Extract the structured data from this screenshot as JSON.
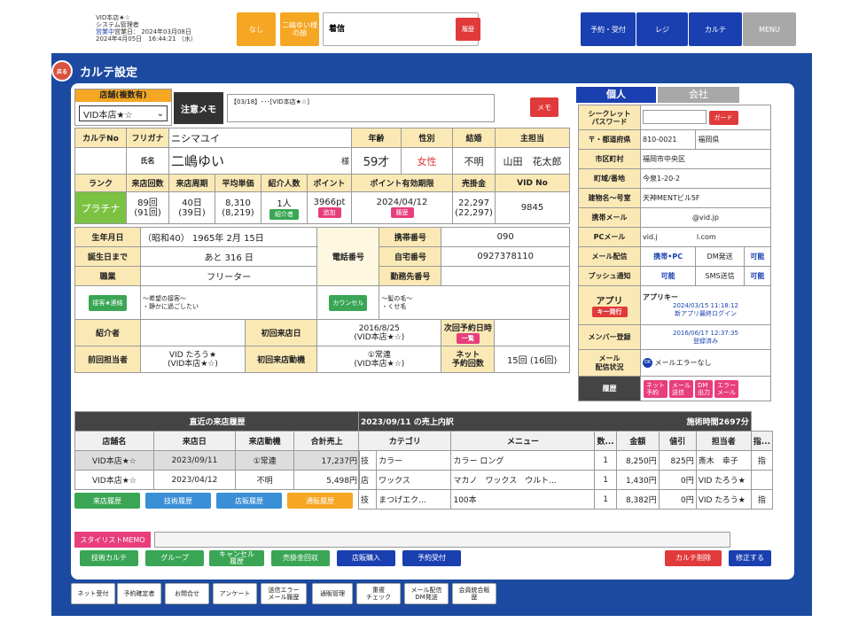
{
  "sysinfo": {
    "store": "VID本店★☆",
    "user": "システム管理者",
    "bizdate_label": "営業中",
    "bizdate": "営業日： 2024年03月08日",
    "now": "2024年4月05日　16:44:21 （水）"
  },
  "top": {
    "none": "なし",
    "customer": "二嶋ゆい様の顔",
    "incoming": "着信",
    "history": "履歴",
    "reserve": "予約・受付",
    "register": "レジ",
    "karte": "カルテ",
    "menu": "MENU"
  },
  "title": "カルテ設定",
  "back": "戻る",
  "store_sel": {
    "label": "店舗(複数有)",
    "value": "VID本店★☆"
  },
  "memo": {
    "label": "注意メモ",
    "text": "【03/18】･･･[VID本店★☆]",
    "btn": "メモ"
  },
  "customer": {
    "h_no": "カルテNo",
    "h_kana": "フリガナ",
    "kana": "ニシマユイ",
    "h_age": "年齢",
    "h_sex": "性別",
    "h_married": "結婚",
    "h_staff": "主担当",
    "h_name": "氏名",
    "name": "二嶋ゆい",
    "sama": "様",
    "age": "59才",
    "sex": "女性",
    "married": "不明",
    "staff": "山田　花太郎",
    "h_rank": "ランク",
    "h_visits": "来店回数",
    "h_cycle": "来店周期",
    "h_avg": "平均単価",
    "h_intro": "紹介人数",
    "h_point": "ポイント",
    "h_pexp": "ポイント有効期限",
    "h_sales": "売掛金",
    "h_vid": "VID No",
    "rank": "プラチナ",
    "visits": "89回\n(91回)",
    "cycle": "40日\n(39日)",
    "avg": "8,310\n(8,219)",
    "intro": "1人",
    "intro_btn": "紹介者",
    "point": "3966pt",
    "point_btn": "追加",
    "pexp": "2024/04/12",
    "pexp_btn": "履歴",
    "sales": "22,297\n(22,297)",
    "vid": "9845",
    "h_birth": "生年月日",
    "birth": "（昭和40） 1965年 2月 15日",
    "h_tel": "電話番号",
    "h_mobile": "携帯番号",
    "mobile": "090",
    "h_tobirth": "誕生日まで",
    "tobirth": "あと 316 日",
    "h_home": "自宅番号",
    "home": "0927378110",
    "h_job": "職業",
    "job": "フリーター",
    "h_work": "勤務先番号",
    "contact_btn": "接客★連絡",
    "contact_note": "～希望の接客～\n・静かに過ごしたい",
    "counsel_btn": "カウンセル",
    "counsel_note": "～髪の毛～\n・くせ毛",
    "h_referrer": "紹介者",
    "h_firstvisit": "初回来店日",
    "firstvisit": "2016/8/25\n(VID本店★☆)",
    "h_nextres": "次回予約日時",
    "nextres_btn": "一覧",
    "h_prevstaff": "前回担当者",
    "prevstaff": "VID たろう★\n(VID本店★☆)",
    "h_firstmotive": "初回来店動機",
    "firstmotive": "①常連\n(VID本店★☆)",
    "h_netres": "ネット\n予約回数",
    "netres": "15回 (16回)"
  },
  "right": {
    "tab_personal": "個人",
    "tab_company": "会社",
    "h_secret": "シークレット\nパスワード",
    "guard": "ガード",
    "h_zip": "〒・都道府県",
    "zip": "810-0021",
    "pref": "福岡県",
    "h_city": "市区町村",
    "city": "福岡市中央区",
    "h_town": "町域/番地",
    "town": "今泉1-20-2",
    "h_bldg": "建物名～号室",
    "bldg": "天神MENTビル5F",
    "h_mobilemail": "携帯メール",
    "mobilemail": "@vid.jp",
    "h_pcmail": "PCメール",
    "pcmail_a": "vid.j",
    "pcmail_b": "l.com",
    "h_maildist": "メール配信",
    "maildist": "携帯•PC",
    "dm": "DM発送",
    "dm_v": "可能",
    "h_push": "プッシュ通知",
    "push": "可能",
    "sms": "SMS送信",
    "sms_v": "可能",
    "h_app": "アプリ",
    "appkey_btn": "キー発行",
    "appkey": "アプリキー",
    "app_login": "2024/03/15 11:18:12\n新アプリ最終ログイン",
    "h_member": "メンバー登録",
    "member": "2016/06/17 12:37:35\n登録済み",
    "h_mailstatus": "メール\n配信状況",
    "mailstatus": "メールエラーなし",
    "h_hist": "履歴",
    "hist_btns": [
      "ネット\n予約",
      "メール\n送信",
      "DM\n出力",
      "エラー\nメール"
    ]
  },
  "recent": {
    "title": "直近の来店履歴",
    "cols": [
      "店舗名",
      "来店日",
      "来店動機",
      "合計売上"
    ],
    "rows": [
      [
        "VID本店★☆",
        "2023/09/11",
        "①常連",
        "17,237円"
      ],
      [
        "VID本店★☆",
        "2023/04/12",
        "不明",
        "5,498円"
      ]
    ],
    "btns": [
      "来店履歴",
      "技術履歴",
      "店販履歴",
      "通販履歴"
    ]
  },
  "sales": {
    "title": "2023/09/11 の売上内訳",
    "time": "施術時間2697分",
    "cols": [
      "カテゴリ",
      "メニュー",
      "数...",
      "金額",
      "値引",
      "担当者",
      "指..."
    ],
    "rows": [
      [
        "技",
        "カラー",
        "カラー ロング",
        "1",
        "8,250円",
        "825円",
        "斎木　幸子",
        "指"
      ],
      [
        "店",
        "ワックス",
        "マカノ　ワックス　ウルト...",
        "1",
        "1,430円",
        "0円",
        "VID たろう★",
        ""
      ],
      [
        "技",
        "まつげエク...",
        "100本",
        "1",
        "8,382円",
        "0円",
        "VID たろう★",
        "指"
      ]
    ]
  },
  "stylist": {
    "label": "スタイリストMEMO"
  },
  "actions": [
    "技術カルテ",
    "グループ",
    "キャンセル\n履歴",
    "売掛金回収",
    "店販購入",
    "予約受付",
    "カルテ削除",
    "修正する"
  ],
  "bottom": [
    "ネット受付",
    "予約確定者",
    "お問合せ",
    "アンケート",
    "送信エラー\nメール履歴",
    "通販管理",
    "重複\nチェック",
    "メール配信\nDM発送",
    "会員統合販\n歴"
  ],
  "colors": {
    "blue": "#1c4aa0",
    "orange": "#f5a623",
    "green": "#3aa655",
    "pink": "#e83e7c",
    "red": "#e03a3a"
  }
}
